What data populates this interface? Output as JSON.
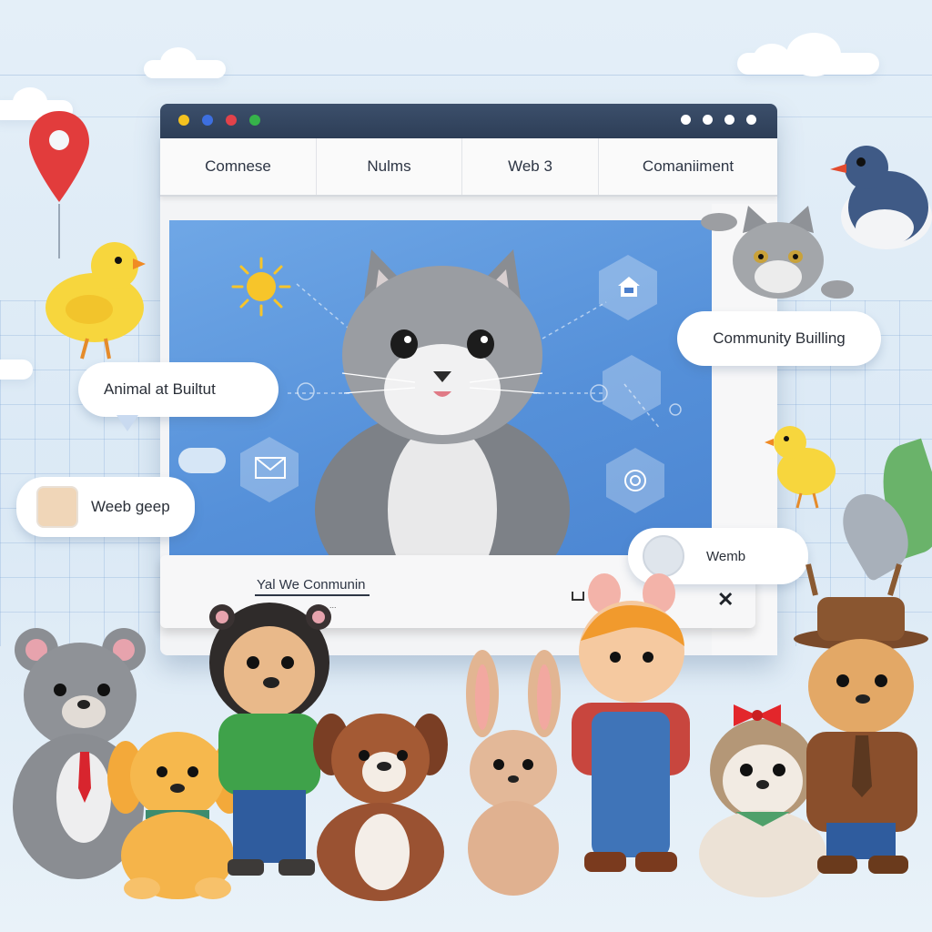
{
  "nav": {
    "tabs": [
      {
        "label": "Comnese"
      },
      {
        "label": "Nulms"
      },
      {
        "label": "Web 3"
      },
      {
        "label": "Comaniiment"
      }
    ]
  },
  "pills": {
    "community_building": "Community Builling",
    "animal_built": "Animal at Builtut",
    "web_geep": "Weeb geep",
    "wemb": "Wemb"
  },
  "footer": {
    "text": "Yal We Conmunin",
    "small_text": "...",
    "close_glyph": "✕"
  },
  "icons": {
    "map_pin": "map-pin-icon",
    "sun": "sun-icon",
    "house": "house-icon",
    "mail": "mail-icon",
    "shield": "shield-icon",
    "camera": "camera-icon",
    "close": "close-icon"
  },
  "colors": {
    "titlebar": "#33465f",
    "hero_blue": "#5590d9",
    "pin_red": "#e23c3c",
    "dot_yellow": "#f4c21f",
    "dot_blue": "#3d6fe0",
    "dot_red": "#e2424a",
    "dot_green": "#36b34a"
  }
}
